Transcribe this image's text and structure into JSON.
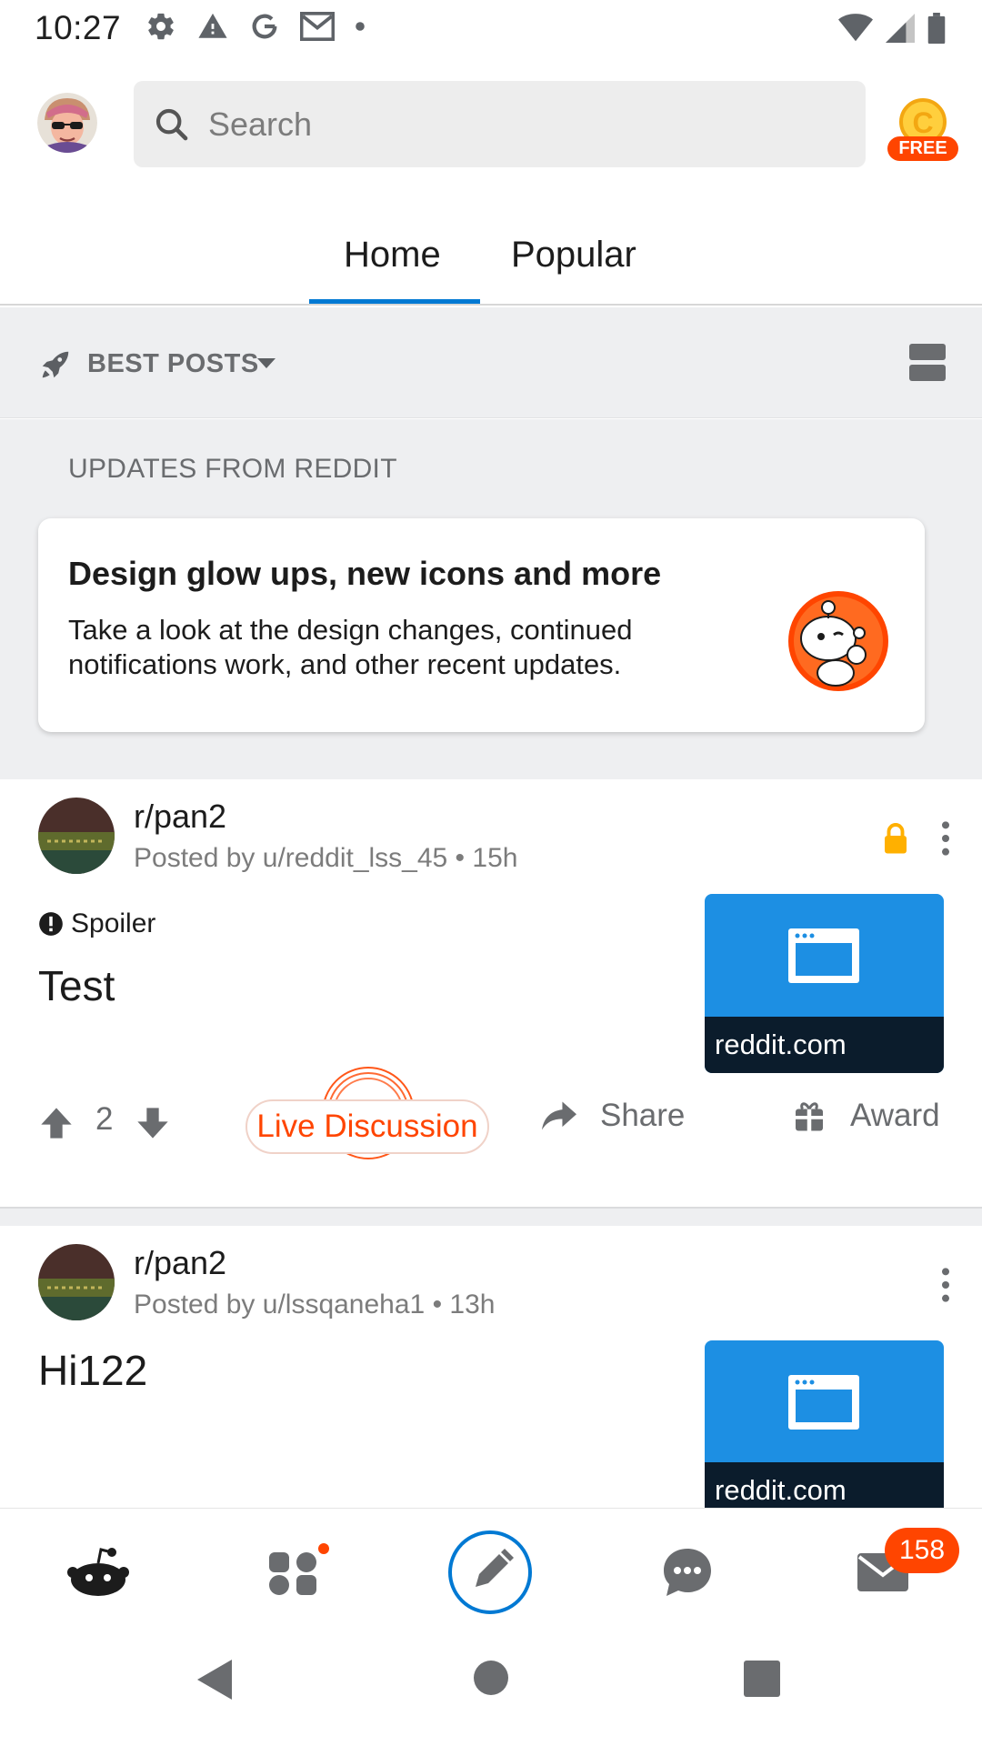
{
  "status_bar": {
    "time": "10:27",
    "icons_left": [
      "gear-icon",
      "warning-icon",
      "google-icon",
      "gmail-icon",
      "dot-icon"
    ],
    "icons_right": [
      "wifi-icon",
      "signal-icon",
      "battery-icon"
    ]
  },
  "header": {
    "search_placeholder": "Search",
    "coins_badge": "FREE"
  },
  "tabs": [
    {
      "label": "Home",
      "active": true
    },
    {
      "label": "Popular",
      "active": false
    }
  ],
  "sort": {
    "label": "BEST POSTS"
  },
  "updates": {
    "section_title": "UPDATES FROM REDDIT",
    "card_title": "Design glow ups, new icons and more",
    "card_body": "Take a look at the design changes, continued notifications work, and other recent updates."
  },
  "posts": [
    {
      "subreddit": "r/pan2",
      "meta": "Posted by u/reddit_lss_45 • 15h",
      "flair": "Spoiler",
      "title": "Test",
      "thumb_label": "reddit.com",
      "votes": "2",
      "live_label": "Live Discussion",
      "share_label": "Share",
      "award_label": "Award",
      "locked": true
    },
    {
      "subreddit": "r/pan2",
      "meta": "Posted by u/lssqaneha1 • 13h",
      "title": "Hi122",
      "thumb_label": "reddit.com"
    }
  ],
  "bottom_nav": {
    "items": [
      "home-icon",
      "communities-icon",
      "create-post-icon",
      "chat-icon",
      "inbox-icon"
    ],
    "inbox_count": "158"
  },
  "colors": {
    "accent": "#0079d3",
    "orange": "#ff4500",
    "feed_bg": "#eeeff1"
  }
}
